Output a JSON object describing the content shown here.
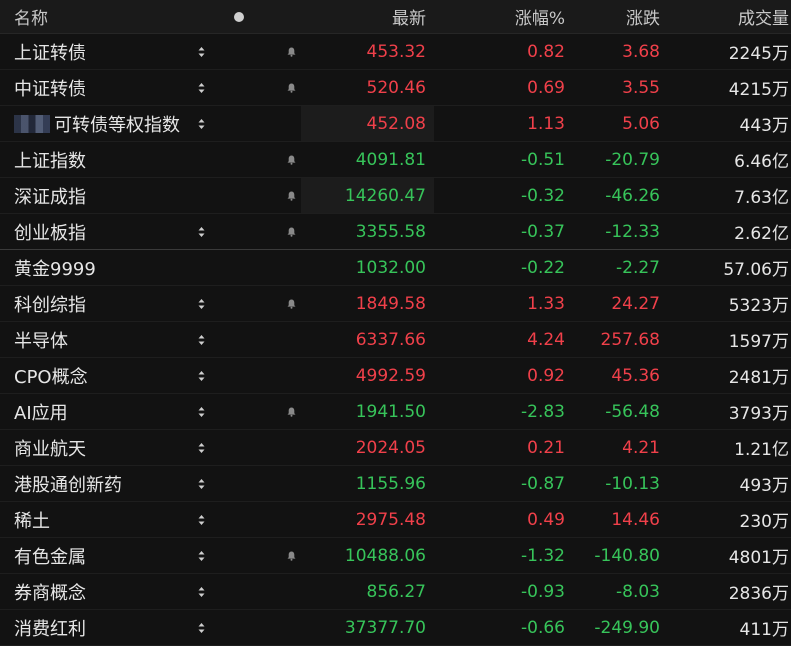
{
  "header": {
    "name": "名称",
    "last": "最新",
    "pct": "涨幅%",
    "chg": "涨跌",
    "volume": "成交量"
  },
  "colors": {
    "up": "#f0404a",
    "down": "#37c45a",
    "neutral": "#e6e6e6"
  },
  "rows": [
    {
      "name": "上证转债",
      "sort": true,
      "bell": true,
      "last": "453.32",
      "pct": "0.82",
      "chg": "3.68",
      "vol": "2245万",
      "trend": "up"
    },
    {
      "name": "中证转债",
      "sort": true,
      "bell": true,
      "last": "520.46",
      "pct": "0.69",
      "chg": "3.55",
      "vol": "4215万",
      "trend": "up"
    },
    {
      "name": "可转债等权指数",
      "sort": true,
      "bell": false,
      "last": "452.08",
      "pct": "1.13",
      "chg": "5.06",
      "vol": "443万",
      "trend": "up",
      "blurred_prefix": true
    },
    {
      "name": "上证指数",
      "sort": false,
      "bell": true,
      "last": "4091.81",
      "pct": "-0.51",
      "chg": "-20.79",
      "vol": "6.46亿",
      "trend": "down"
    },
    {
      "name": "深证成指",
      "sort": false,
      "bell": true,
      "last": "14260.47",
      "pct": "-0.32",
      "chg": "-46.26",
      "vol": "7.63亿",
      "trend": "down"
    },
    {
      "name": "创业板指",
      "sort": true,
      "bell": true,
      "last": "3355.58",
      "pct": "-0.37",
      "chg": "-12.33",
      "vol": "2.62亿",
      "trend": "down"
    },
    {
      "name": "黄金9999",
      "sort": false,
      "bell": false,
      "last": "1032.00",
      "pct": "-0.22",
      "chg": "-2.27",
      "vol": "57.06万",
      "trend": "down"
    },
    {
      "name": "科创综指",
      "sort": true,
      "bell": true,
      "last": "1849.58",
      "pct": "1.33",
      "chg": "24.27",
      "vol": "5323万",
      "trend": "up"
    },
    {
      "name": "半导体",
      "sort": true,
      "bell": false,
      "last": "6337.66",
      "pct": "4.24",
      "chg": "257.68",
      "vol": "1597万",
      "trend": "up"
    },
    {
      "name": "CPO概念",
      "sort": true,
      "bell": false,
      "last": "4992.59",
      "pct": "0.92",
      "chg": "45.36",
      "vol": "2481万",
      "trend": "up"
    },
    {
      "name": "AI应用",
      "sort": true,
      "bell": true,
      "last": "1941.50",
      "pct": "-2.83",
      "chg": "-56.48",
      "vol": "3793万",
      "trend": "down"
    },
    {
      "name": "商业航天",
      "sort": true,
      "bell": false,
      "last": "2024.05",
      "pct": "0.21",
      "chg": "4.21",
      "vol": "1.21亿",
      "trend": "up"
    },
    {
      "name": "港股通创新药",
      "sort": true,
      "bell": false,
      "last": "1155.96",
      "pct": "-0.87",
      "chg": "-10.13",
      "vol": "493万",
      "trend": "down"
    },
    {
      "name": "稀土",
      "sort": true,
      "bell": false,
      "last": "2975.48",
      "pct": "0.49",
      "chg": "14.46",
      "vol": "230万",
      "trend": "up"
    },
    {
      "name": "有色金属",
      "sort": true,
      "bell": true,
      "last": "10488.06",
      "pct": "-1.32",
      "chg": "-140.80",
      "vol": "4801万",
      "trend": "down"
    },
    {
      "name": "券商概念",
      "sort": true,
      "bell": false,
      "last": "856.27",
      "pct": "-0.93",
      "chg": "-8.03",
      "vol": "2836万",
      "trend": "down"
    },
    {
      "name": "消费红利",
      "sort": true,
      "bell": false,
      "last": "37377.70",
      "pct": "-0.66",
      "chg": "-249.90",
      "vol": "411万",
      "trend": "down"
    }
  ]
}
